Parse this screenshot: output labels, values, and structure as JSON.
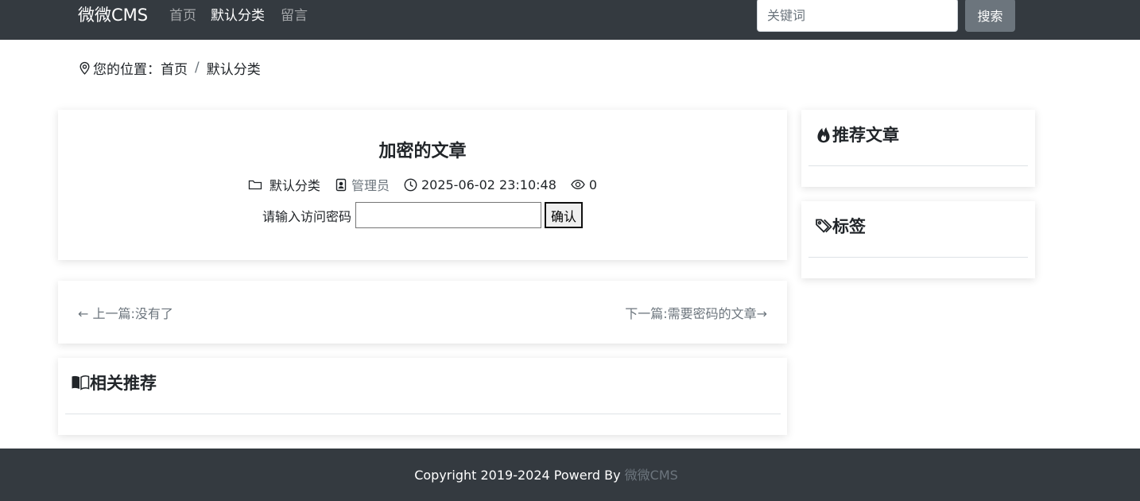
{
  "navbar": {
    "brand": "微微CMS",
    "links": [
      {
        "label": "首页"
      },
      {
        "label": "默认分类"
      },
      {
        "label": "留言"
      }
    ],
    "search": {
      "placeholder": "关键词",
      "value": ""
    },
    "search_button": "搜索"
  },
  "breadcrumb": {
    "prefix": "您的位置：",
    "items": [
      "首页",
      "默认分类"
    ],
    "separator": "/"
  },
  "post": {
    "title": "加密的文章",
    "category": "默认分类",
    "author": "管理员",
    "datetime": "2025-06-02 23:10:48",
    "views": "0",
    "password_prompt": "请输入访问密码",
    "password_value": "",
    "confirm_button": "确认"
  },
  "post_nav": {
    "prev": "← 上一篇:没有了",
    "next": "下一篇:需要密码的文章→"
  },
  "related": {
    "heading": "相关推荐"
  },
  "sidebar": {
    "recommended_heading": "推荐文章",
    "tags_heading": "标签"
  },
  "footer": {
    "text": "Copyright 2019-2024 Powerd By ",
    "link": "微微CMS"
  },
  "colors": {
    "navbar_bg": "#343a40",
    "muted_link": "#6c757d",
    "search_button_bg": "#6c757d"
  }
}
